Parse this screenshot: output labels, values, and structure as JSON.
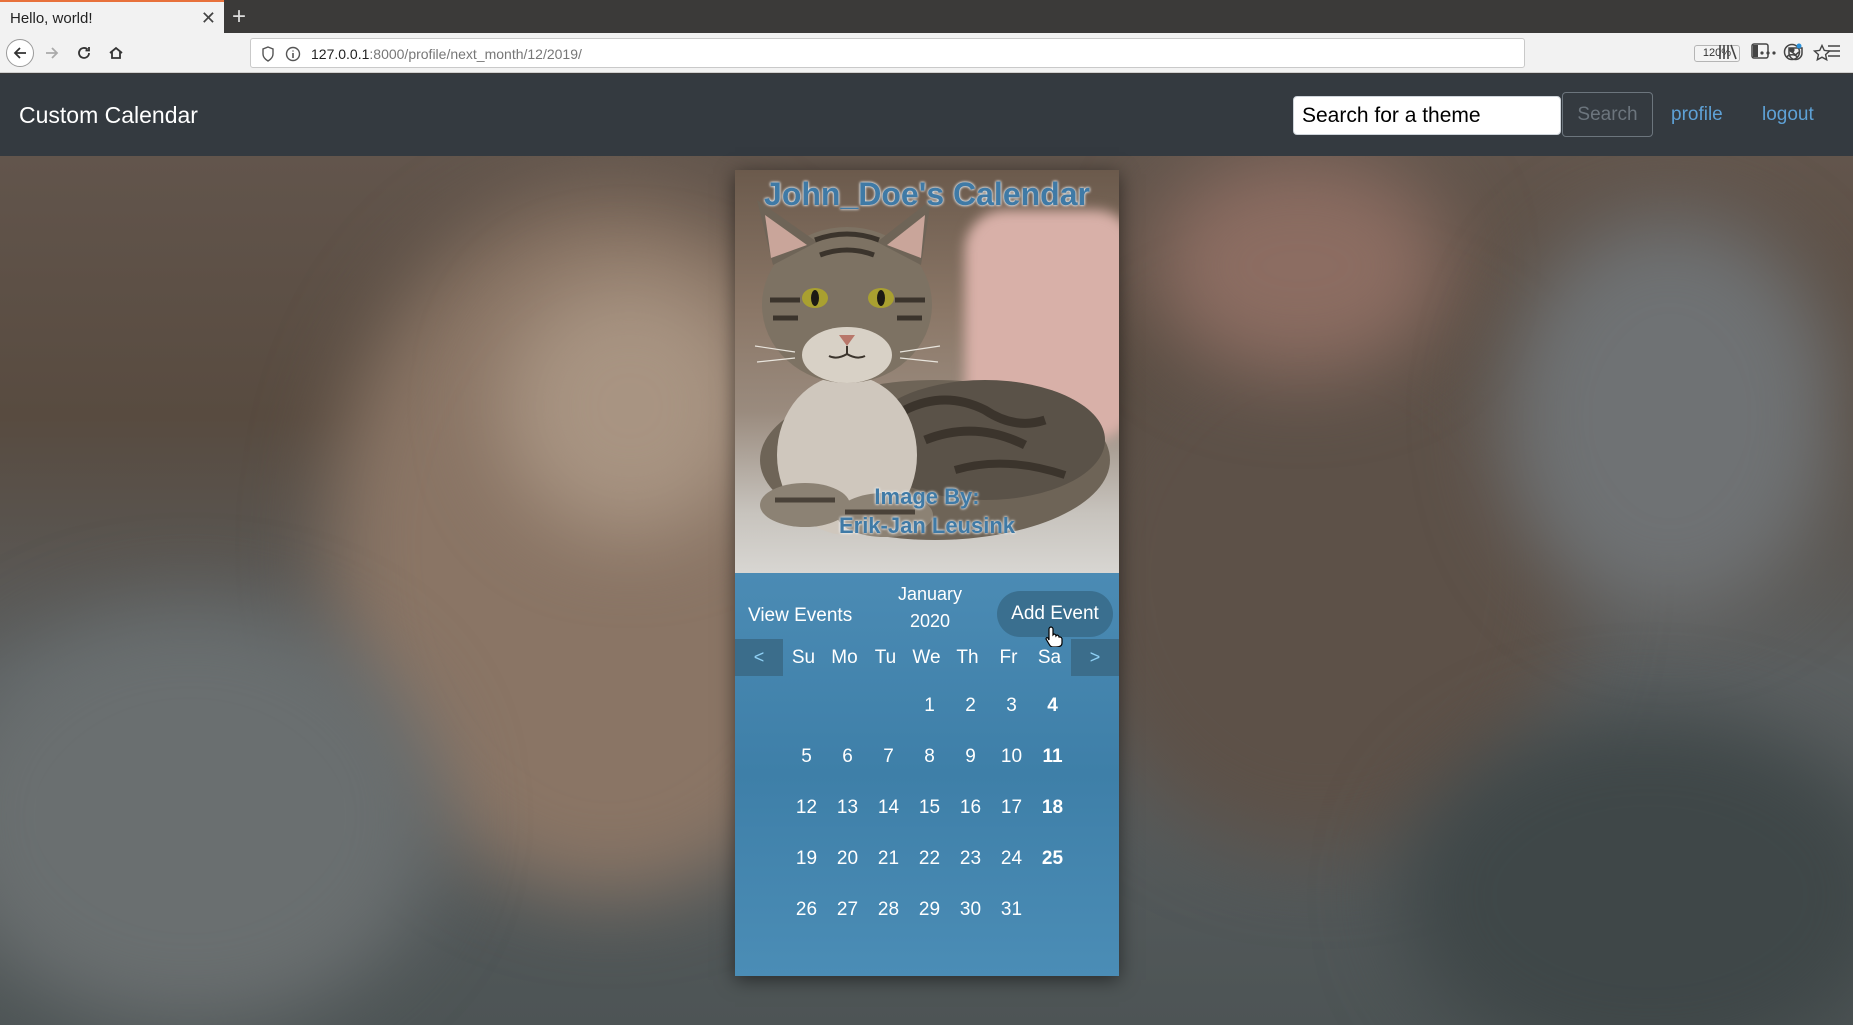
{
  "browser": {
    "tab_title": "Hello, world!",
    "url_host": "127.0.0.1",
    "url_rest": ":8000/profile/next_month/12/2019/",
    "zoom": "120%"
  },
  "app": {
    "brand": "Custom Calendar",
    "search_value": "Search for a theme",
    "search_button": "Search",
    "profile_link": "profile",
    "logout_link": "logout"
  },
  "calendar": {
    "title": "John_Doe's Calendar",
    "credit_line1": "Image By:",
    "credit_line2": "Erik-Jan Leusink",
    "view_events": "View Events",
    "month": "January",
    "year": "2020",
    "add_event": "Add Event",
    "prev": "<",
    "next": ">",
    "weekdays": [
      "Su",
      "Mo",
      "Tu",
      "We",
      "Th",
      "Fr",
      "Sa"
    ],
    "weeks": [
      [
        "",
        "",
        "",
        "1",
        "2",
        "3",
        "4"
      ],
      [
        "5",
        "6",
        "7",
        "8",
        "9",
        "10",
        "11"
      ],
      [
        "12",
        "13",
        "14",
        "15",
        "16",
        "17",
        "18"
      ],
      [
        "19",
        "20",
        "21",
        "22",
        "23",
        "24",
        "25"
      ],
      [
        "26",
        "27",
        "28",
        "29",
        "30",
        "31",
        ""
      ]
    ]
  },
  "colors": {
    "navbar_bg": "#343a40",
    "link": "#5ea1d6",
    "calendar_blue": "#4487b0",
    "title_blue": "#3f7aa6"
  }
}
